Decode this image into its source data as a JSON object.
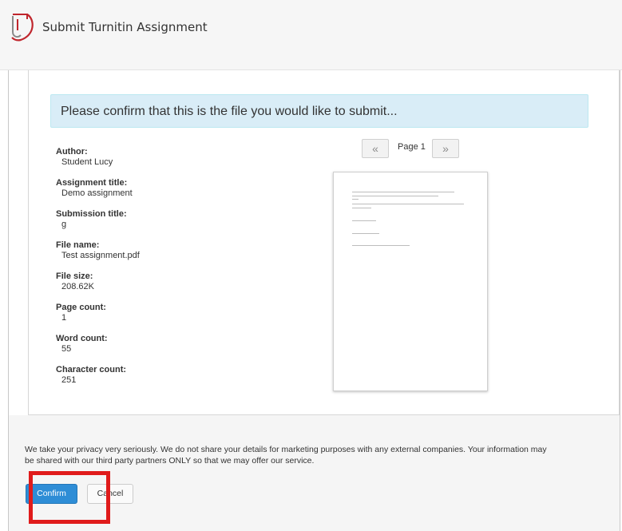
{
  "header": {
    "title": "Submit Turnitin Assignment",
    "logo_icon": "turnitin-logo-icon"
  },
  "banner": {
    "text": "Please confirm that this is the file you would like to submit..."
  },
  "details": [
    {
      "label": "Author:",
      "value": "Student Lucy"
    },
    {
      "label": "Assignment title:",
      "value": "Demo assignment"
    },
    {
      "label": "Submission title:",
      "value": "g"
    },
    {
      "label": "File name:",
      "value": "Test assignment.pdf"
    },
    {
      "label": "File size:",
      "value": "208.62K"
    },
    {
      "label": "Page count:",
      "value": "1"
    },
    {
      "label": "Word count:",
      "value": "55"
    },
    {
      "label": "Character count:",
      "value": "251"
    }
  ],
  "pager": {
    "prev": "«",
    "label": "Page 1",
    "next": "»"
  },
  "footer": {
    "privacy": "We take your privacy very seriously. We do not share your details for marketing purposes with any external companies. Your information may be shared with our third party partners ONLY so that we may offer our service.",
    "confirm_label": "Confirm",
    "cancel_label": "Cancel"
  },
  "colors": {
    "accent": "#2e8dd6",
    "banner_bg": "#d9edf7",
    "highlight": "#e01b1b"
  }
}
